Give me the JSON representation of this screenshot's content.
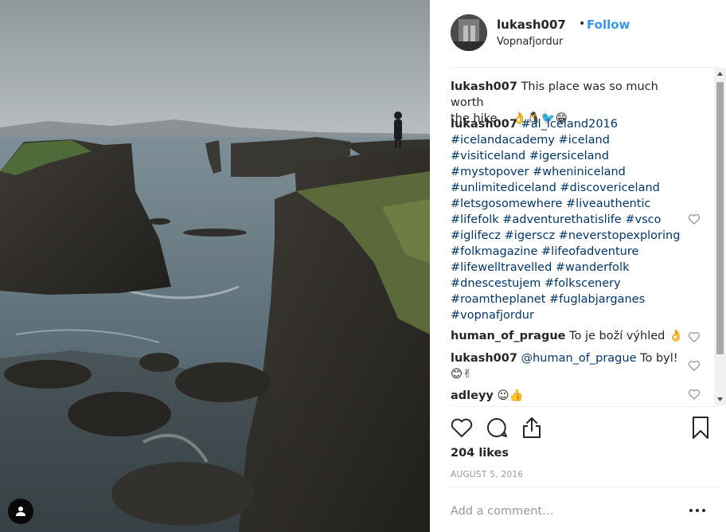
{
  "post": {
    "username": "lukash007",
    "separator": "•",
    "follow_label": "Follow",
    "location": "Vopnafjordur"
  },
  "comments": [
    {
      "user": "lukash007",
      "text": "This place was so much worth the hike… 👌🐧🐦😁"
    },
    {
      "user": "lukash007",
      "text": "#al_iceland2016 #icelandacademy #iceland #visiticeland #igersiceland #mystopover #wheniniceland #unlimitediceland #discovericeland #letsgosomewhere #liveauthentic #lifefolk #adventurethatislife #vsco #iglifecz #igerscz #neverstopexploring #folkmagazine #lifeofadventure #lifewelltravelled #wanderfolk #dnescestujem #folkscenery #roamtheplanet #fuglabjarganes #vopnafjordur"
    },
    {
      "user": "human_of_prague",
      "text": "To je boží výhled 👌"
    },
    {
      "user": "lukash007",
      "text": "@human_of_prague To byl! 😊✌"
    },
    {
      "user": "adleyy",
      "text": "☺👍"
    }
  ],
  "hashtag_lines": [
    "#al_iceland2016",
    "#icelandacademy #iceland",
    "#visiticeland #igersiceland",
    "#mystopover #wheniniceland",
    "#unlimitediceland #discovericeland",
    "#letsgosomewhere #liveauthentic",
    "#lifefolk #adventurethatislife #vsco",
    "#iglifecz #igerscz #neverstopexploring",
    "#folkmagazine #lifeofadventure",
    "#lifewelltravelled #wanderfolk",
    "#dnescestujem #folkscenery",
    "#roamtheplanet #fuglabjarganes",
    "#vopnafjordur"
  ],
  "caption_line1": "This place was so much worth",
  "caption_line2": "the hike… 👌🐧🐦😁",
  "reply_mention": "@human_of_prague",
  "reply_text": " To byl!",
  "reply_emoji": "😊✌",
  "likes": "204 likes",
  "date": "AUGUST 5, 2016",
  "add_comment_placeholder": "Add a comment…",
  "icons": {
    "like": "heart-icon",
    "comment": "comment-icon",
    "share": "share-icon",
    "save": "bookmark-icon",
    "more": "more-icon",
    "tag": "user-tag-icon"
  },
  "colors": {
    "link": "#3897f0",
    "hashtag": "#00376b",
    "muted": "#999999",
    "text": "#262626"
  }
}
